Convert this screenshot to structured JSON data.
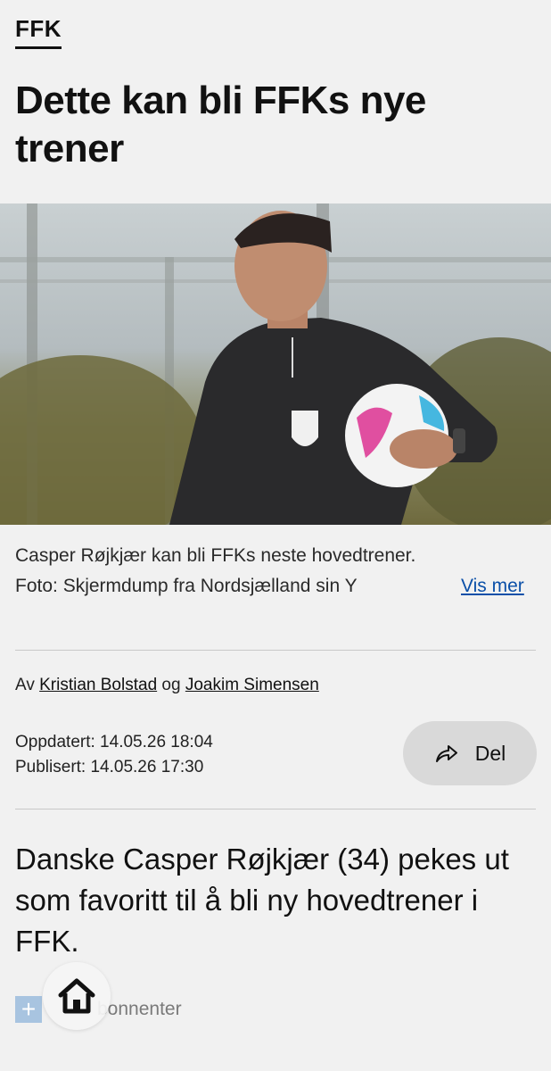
{
  "section": {
    "tag": "FFK"
  },
  "article": {
    "headline": "Dette kan bli FFKs nye trener",
    "image_alt": "Casper Røjkjær holding a football",
    "caption_line1": "Casper Røjkjær kan bli FFKs neste hovedtrener.",
    "caption_line2": "Foto: Skjermdump fra Nordsjælland sin Y",
    "vis_mer": "Vis mer",
    "byline_prefix": "Av",
    "author1": "Kristian Bolstad",
    "byline_and": "og",
    "author2": "Joakim Simensen",
    "updated": "Oppdatert: 14.05.26 18:04",
    "published": "Publisert: 14.05.26 17:30",
    "share_label": "Del",
    "lead": "Danske Casper Røjkjær (34) pekes ut som favoritt til å bli ny hovedtrener i FFK.",
    "subscriber_text": "bonnenter"
  },
  "icons": {
    "share": "share-arrow-icon",
    "home": "home-icon",
    "plus": "plus-icon"
  },
  "colors": {
    "background": "#f1f1f1",
    "link": "#0a4fa8",
    "share_button": "#d9d9d9",
    "subscriber_badge": "#a8c4e0"
  }
}
